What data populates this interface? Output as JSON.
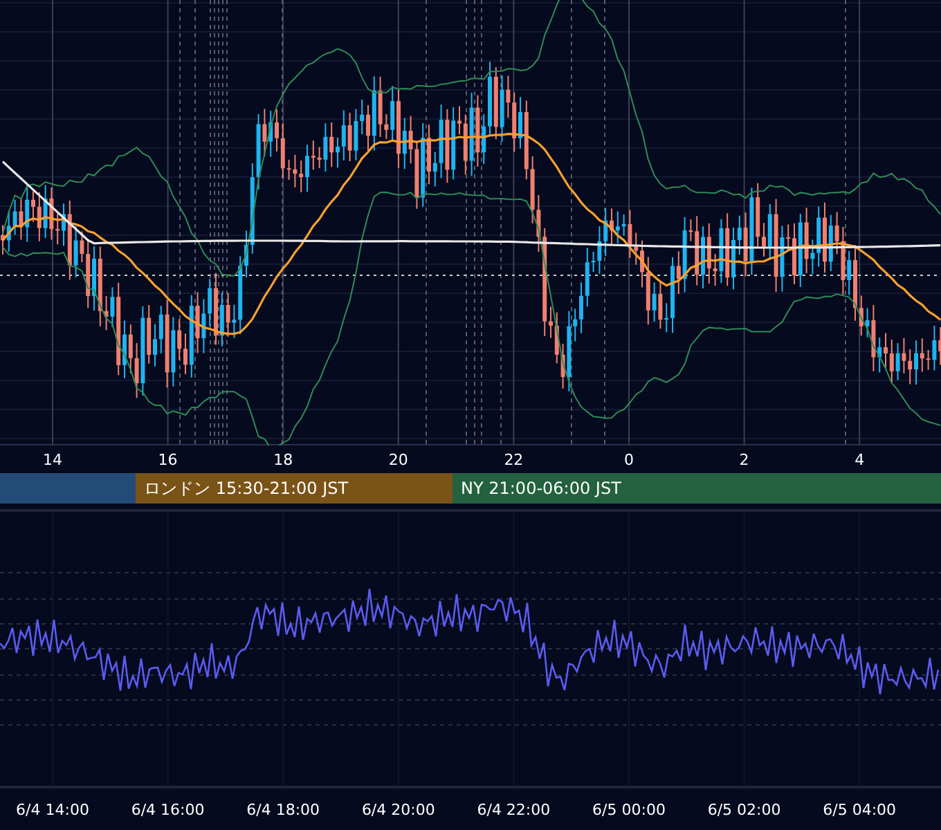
{
  "main_chart": {
    "hour_labels": [
      "14",
      "16",
      "18",
      "20",
      "22",
      "0",
      "2",
      "4"
    ]
  },
  "sessions": [
    {
      "color": "#224b78"
    },
    {
      "label": "ロンドン 15:30-21:00 JST",
      "color": "#7a5317"
    },
    {
      "label": "NY 21:00-06:00 JST",
      "color": "#23613f"
    }
  ],
  "oscillator": {
    "time_labels": [
      "6/4 14:00",
      "6/4 16:00",
      "6/4 18:00",
      "6/4 20:00",
      "6/4 22:00",
      "6/5 00:00",
      "6/5 02:00",
      "6/5 04:00"
    ]
  }
}
